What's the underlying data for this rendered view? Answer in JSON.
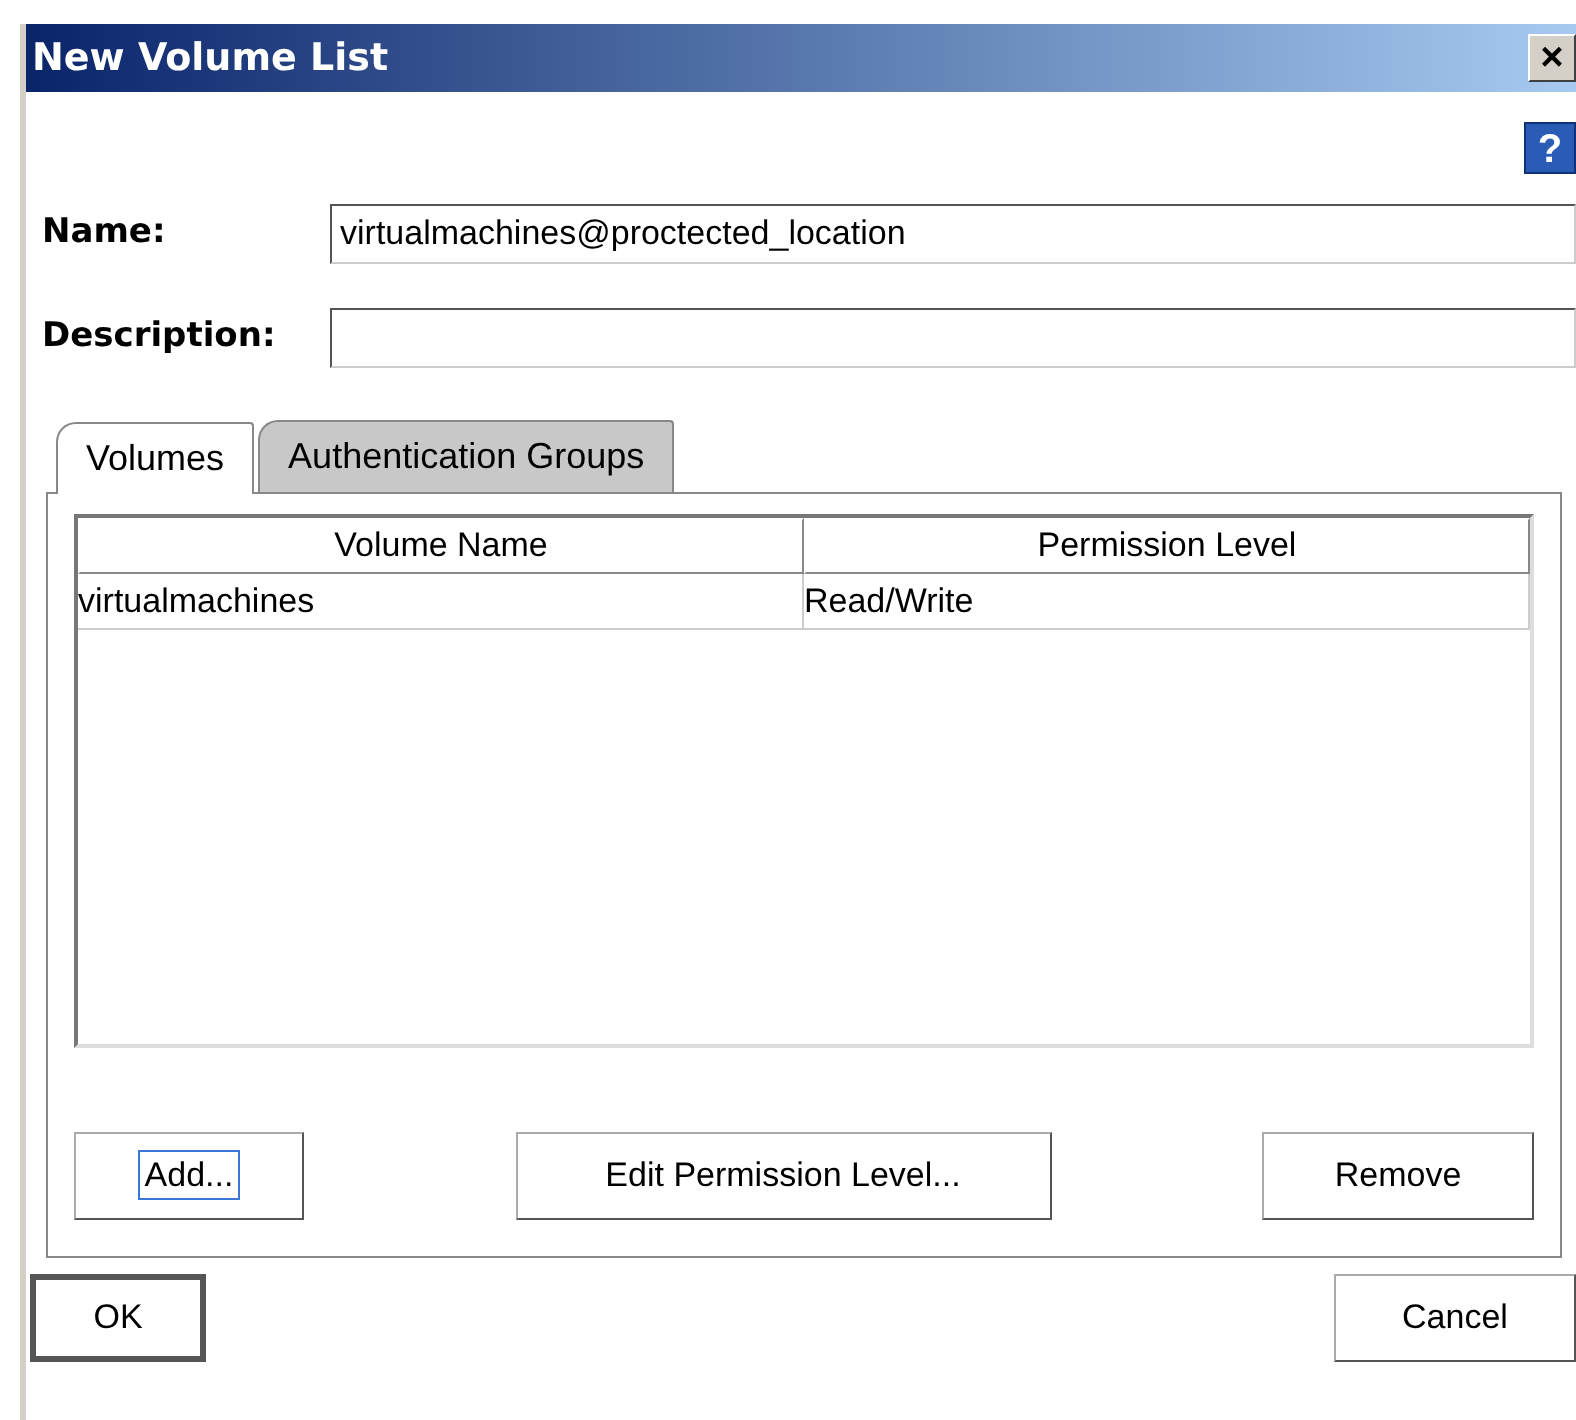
{
  "window": {
    "title": "New Volume List",
    "close": "×",
    "help": "?"
  },
  "fields": [
    {
      "label": "Name:",
      "value": "virtualmachines@proctected_location"
    },
    {
      "label": "Description:"
    }
  ],
  "tabs": [
    {
      "label": "Volumes",
      "selected": true
    },
    {
      "label": "Authentication Groups",
      "selected": false
    }
  ],
  "table": {
    "columns": [
      "Volume Name",
      "Permission Level"
    ],
    "rows": [
      [
        "virtualmachines",
        "Read/Write"
      ]
    ]
  },
  "panel_buttons": [
    {
      "label": "Add...",
      "focused": true
    },
    {
      "label": "Edit Permission Level...",
      "focused": false
    },
    {
      "label": "Remove",
      "focused": false
    }
  ],
  "dialog_buttons": [
    {
      "label": "OK",
      "default": true
    },
    {
      "label": "Cancel",
      "default": false
    }
  ]
}
